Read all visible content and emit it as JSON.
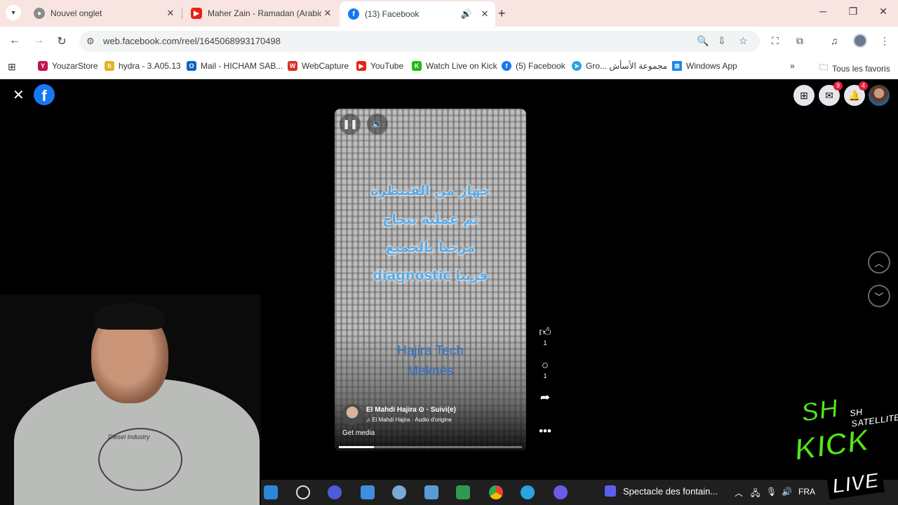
{
  "browser": {
    "tabs": [
      {
        "title": "Nouvel onglet",
        "icon": "chrome-icon",
        "color": "#9e9e9e"
      },
      {
        "title": "Maher Zain - Ramadan (Arabic)",
        "icon": "youtube-icon",
        "color": "#e62117"
      },
      {
        "title": "(13) Facebook",
        "icon": "facebook-icon",
        "color": "#1877f2"
      }
    ],
    "url": "web.facebook.com/reel/1645068993170498",
    "bookmarks": [
      {
        "label": "YouzarStore",
        "icon": "youzar-icon",
        "color": "#c6124f"
      },
      {
        "label": "hydra - 3.A05.13",
        "icon": "hydra-icon",
        "color": "#e3b21b"
      },
      {
        "label": "Mail - HICHAM SAB...",
        "icon": "mail-icon",
        "color": "#0a64c9"
      },
      {
        "label": "WebCapture",
        "icon": "webcapture-icon",
        "color": "#d9301f"
      },
      {
        "label": "YouTube",
        "icon": "youtube-icon",
        "color": "#e62117"
      },
      {
        "label": "Watch Live on Kick",
        "icon": "kick-icon",
        "color": "#1fbb12"
      },
      {
        "label": "(5) Facebook",
        "icon": "facebook-icon",
        "color": "#1877f2"
      },
      {
        "label": "Gro... مجموعة الأسأش",
        "icon": "telegram-icon",
        "color": "#2aa3de"
      },
      {
        "label": "Windows App",
        "icon": "windows-icon",
        "color": "#1e88e5"
      }
    ],
    "all_bookmarks": "Tous les favoris"
  },
  "facebook": {
    "messenger_badge": "9",
    "notifications_badge": "4",
    "reel": {
      "overlay_lines": [
        "جهاز من القنيطرة",
        "تم عملية بنجاح",
        "مرحبا بالجميع",
        "diagnostic قريبا"
      ],
      "tech_line1": "Hajira Tech",
      "tech_line2": "Meknès",
      "author": "El Mahdi Hajira",
      "follow": "· Suivi(e)",
      "audio": "♫ El Mahdi Hajira · Audio d'origine",
      "get_media": "Get media",
      "progress": 0.19
    },
    "likes": "1",
    "comments": "1"
  },
  "webcam": {
    "shirt_text": "Diesel Industry"
  },
  "kick_logo": {
    "sh": "SH",
    "satellite": "SH SATELLITE",
    "kick": "KICK",
    "live": "LIVE"
  },
  "taskbar": {
    "media_title": "Spectacle des fontain...",
    "language": "FRA"
  }
}
